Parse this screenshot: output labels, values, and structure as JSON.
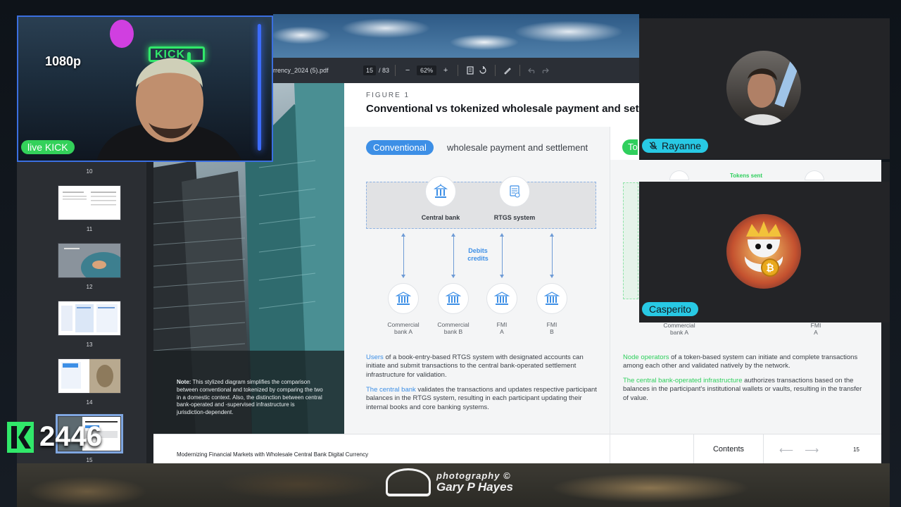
{
  "viewer": {
    "file_name": "rrency_2024 (5).pdf",
    "current_page": "15",
    "page_total": "/ 83",
    "zoom": "62%",
    "zoom_out": "−",
    "zoom_in": "+"
  },
  "thumbnails": [
    {
      "num": "10"
    },
    {
      "num": "11"
    },
    {
      "num": "12"
    },
    {
      "num": "13"
    },
    {
      "num": "14"
    },
    {
      "num": "15"
    }
  ],
  "page": {
    "note_label": "Note:",
    "note_text": " This stylized diagram simplifies the comparison between conventional and tokenized by comparing the two in a domestic context. Also, the distinction between central bank-operated and -supervised infrastructure is jurisdiction-dependent.",
    "figure_label": "FIGURE 1",
    "figure_title": "Conventional vs tokenized wholesale payment and settl",
    "pill": "Conventional",
    "pill_after": "wholesale payment and settlement",
    "central_bank": "Central bank",
    "rtgs": "RTGS system",
    "debits": "Debits",
    "credits": "credits",
    "nodes": [
      {
        "l1": "Commercial",
        "l2": "bank A"
      },
      {
        "l1": "Commercial",
        "l2": "bank B"
      },
      {
        "l1": "FMI",
        "l2": "A"
      },
      {
        "l1": "FMI",
        "l2": "B"
      }
    ],
    "p1_hl": "Users",
    "p1_text": " of a book-entry-based RTGS system with designated accounts can initiate and submit transactions to the central bank-operated settlement infrastructure for validation.",
    "p2_hl": "The central bank",
    "p2_text": " validates the transactions and updates respective participant balances in the RTGS system, resulting in each participant updating their internal books and core banking systems.",
    "footer": "Modernizing Financial Markets with Wholesale Central Bank Digital Currency"
  },
  "right_page": {
    "pill_fragment": "To",
    "tokens_sent": "Tokens sent",
    "node_left_1": "Commercial",
    "node_left_2": "bank A",
    "node_right_1": "FMI",
    "node_right_2": "A",
    "p1_hl": "Node operators",
    "p1_text": " of a token-based system can initiate and complete transactions among each other and validated natively by the network.",
    "p2_hl": "The central bank-operated infrastructure",
    "p2_text": " authorizes transactions based on the balances in the participant's institutional wallets or vaults, resulting in the transfer of value.",
    "contents": "Contents",
    "prev_arrow": "⟵",
    "next_arrow": "⟶",
    "page_num": "15"
  },
  "stream": {
    "resolution": "1080p",
    "live_badge": "live KICK",
    "viewer_count": "2446",
    "neon_sign": "KICK"
  },
  "participants": [
    {
      "name": "Rayanne",
      "muted": true
    },
    {
      "name": "Casperito",
      "muted": false
    }
  ],
  "watermark": {
    "line1": "photography ©",
    "line2": "Gary P Hayes"
  },
  "colors": {
    "accent_blue": "#3d8fe6",
    "accent_green": "#2fcf5d",
    "kick_green": "#31e86a",
    "name_badge": "#28c9e4"
  }
}
